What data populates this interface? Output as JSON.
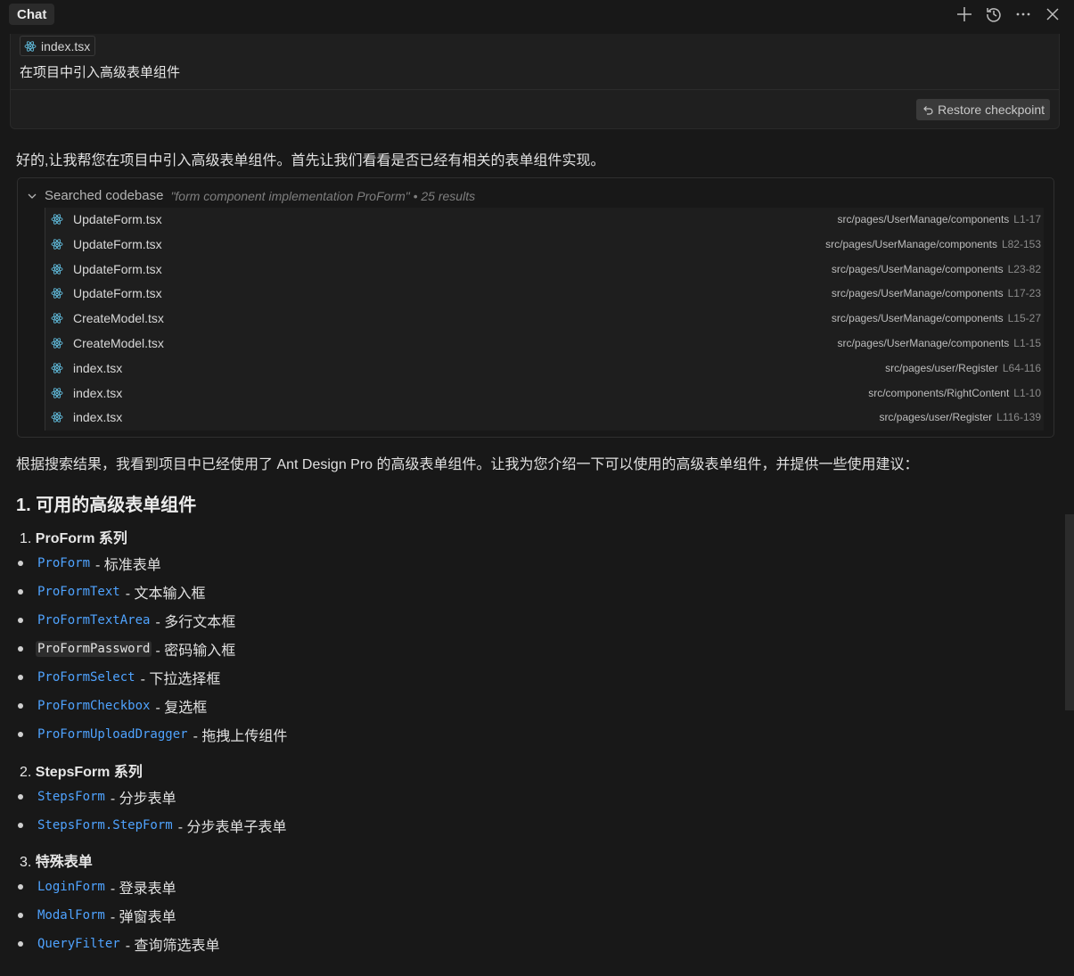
{
  "header": {
    "title": "Chat"
  },
  "user_message": {
    "file_chip": "index.tsx",
    "text": "在项目中引入高级表单组件",
    "restore_label": "Restore checkpoint"
  },
  "intro": "好的,让我帮您在项目中引入高级表单组件。首先让我们看看是否已经有相关的表单组件实现。",
  "search": {
    "label": "Searched codebase",
    "query": "\"form component implementation ProForm\" • 25 results",
    "results": [
      {
        "name": "UpdateForm.tsx",
        "path": "src/pages/UserManage/components",
        "lines": "L1-17"
      },
      {
        "name": "UpdateForm.tsx",
        "path": "src/pages/UserManage/components",
        "lines": "L82-153"
      },
      {
        "name": "UpdateForm.tsx",
        "path": "src/pages/UserManage/components",
        "lines": "L23-82"
      },
      {
        "name": "UpdateForm.tsx",
        "path": "src/pages/UserManage/components",
        "lines": "L17-23"
      },
      {
        "name": "CreateModel.tsx",
        "path": "src/pages/UserManage/components",
        "lines": "L15-27"
      },
      {
        "name": "CreateModel.tsx",
        "path": "src/pages/UserManage/components",
        "lines": "L1-15"
      },
      {
        "name": "index.tsx",
        "path": "src/pages/user/Register",
        "lines": "L64-116"
      },
      {
        "name": "index.tsx",
        "path": "src/components/RightContent",
        "lines": "L1-10"
      },
      {
        "name": "index.tsx",
        "path": "src/pages/user/Register",
        "lines": "L116-139"
      }
    ]
  },
  "summary": "根据搜索结果，我看到项目中已经使用了 Ant Design Pro 的高级表单组件。让我为您介绍一下可以使用的高级表单组件，并提供一些使用建议：",
  "section_title": "1. 可用的高级表单组件",
  "groups": [
    {
      "number": "1.",
      "title": "ProForm 系列",
      "items": [
        {
          "code": "ProForm",
          "desc": "- 标准表单"
        },
        {
          "code": "ProFormText",
          "desc": "- 文本输入框"
        },
        {
          "code": "ProFormTextArea",
          "desc": "- 多行文本框"
        },
        {
          "code": "ProFormPassword",
          "desc": "- 密码输入框"
        },
        {
          "code": "ProFormSelect",
          "desc": "- 下拉选择框"
        },
        {
          "code": "ProFormCheckbox",
          "desc": "- 复选框"
        },
        {
          "code": "ProFormUploadDragger",
          "desc": "- 拖拽上传组件"
        }
      ]
    },
    {
      "number": "2.",
      "title": "StepsForm 系列",
      "items": [
        {
          "code": "StepsForm",
          "desc": "- 分步表单"
        },
        {
          "code": "StepsForm.StepForm",
          "desc": "- 分步表单子表单"
        }
      ]
    },
    {
      "number": "3.",
      "title": "特殊表单",
      "items": [
        {
          "code": "LoginForm",
          "desc": "- 登录表单"
        },
        {
          "code": "ModalForm",
          "desc": "- 弹窗表单"
        },
        {
          "code": "QueryFilter",
          "desc": "- 查询筛选表单"
        }
      ]
    }
  ],
  "colors": {
    "background": "#181818",
    "link_code": "#4fa3ff",
    "react_icon": "#5fb8d8"
  }
}
